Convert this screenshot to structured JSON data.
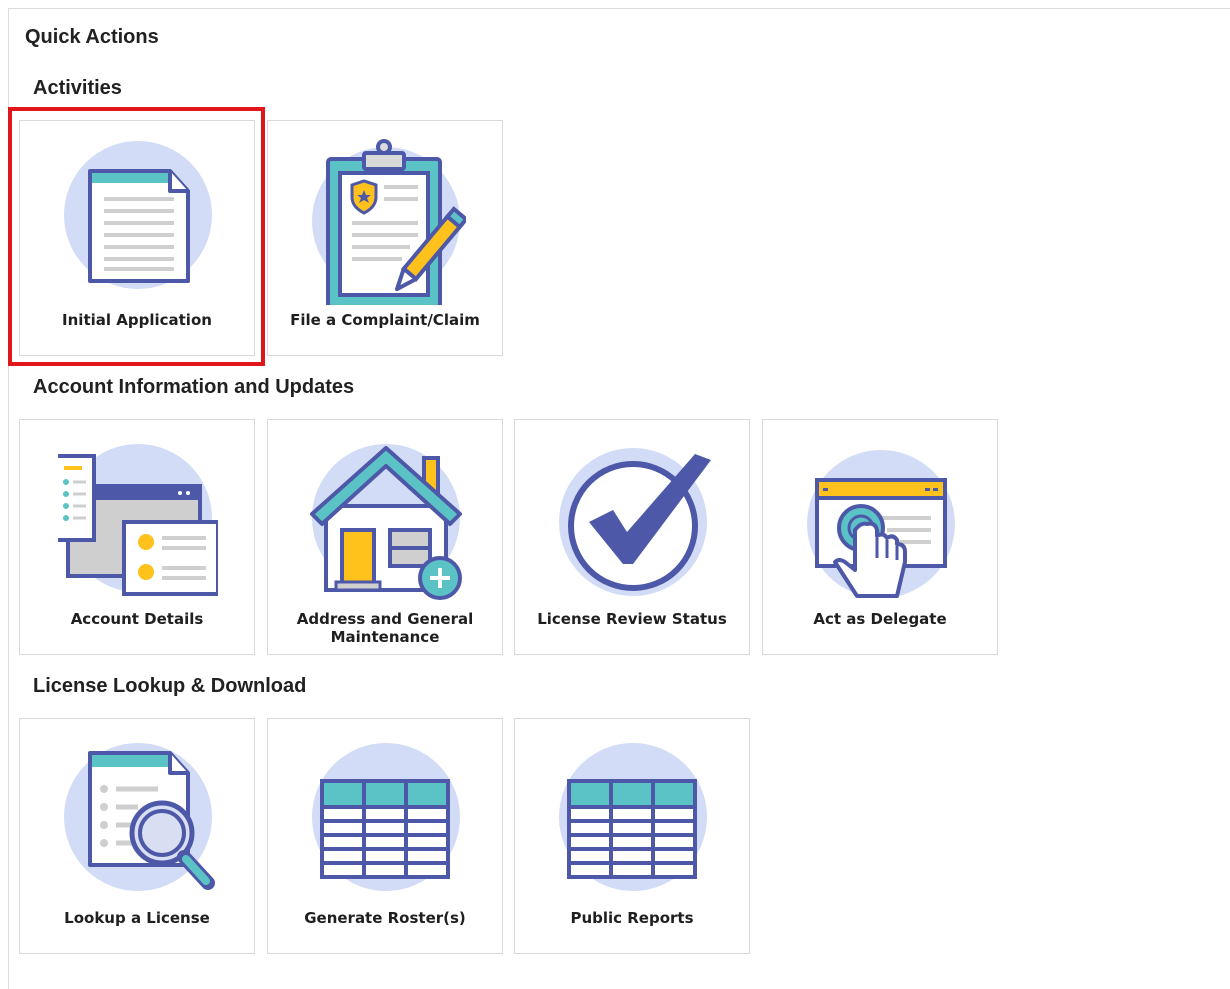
{
  "title": "Quick Actions",
  "sections": {
    "activities": {
      "heading": "Activities",
      "tiles": [
        "Initial Application",
        "File a Complaint/Claim"
      ]
    },
    "account": {
      "heading": "Account Information and Updates",
      "tiles": [
        "Account Details",
        "Address and General Maintenance",
        "License Review Status",
        "Act as Delegate"
      ]
    },
    "lookup": {
      "heading": "License Lookup & Download",
      "tiles": [
        "Lookup a License",
        "Generate Roster(s)",
        "Public Reports"
      ]
    }
  },
  "icons": {
    "initial_application": "document-icon",
    "file_complaint": "clipboard-pencil-icon",
    "account_details": "account-windows-icon",
    "address_maintenance": "house-plus-icon",
    "license_review": "checkmark-icon",
    "act_as_delegate": "hand-click-icon",
    "lookup_license": "document-magnifier-icon",
    "generate_roster": "table-icon",
    "public_reports": "table-icon"
  },
  "colors": {
    "circle": "#d3dcf6",
    "outline": "#4d58a8",
    "teal": "#5bc3c6",
    "yellow": "#ffc21c",
    "highlight": "#e0161b"
  }
}
